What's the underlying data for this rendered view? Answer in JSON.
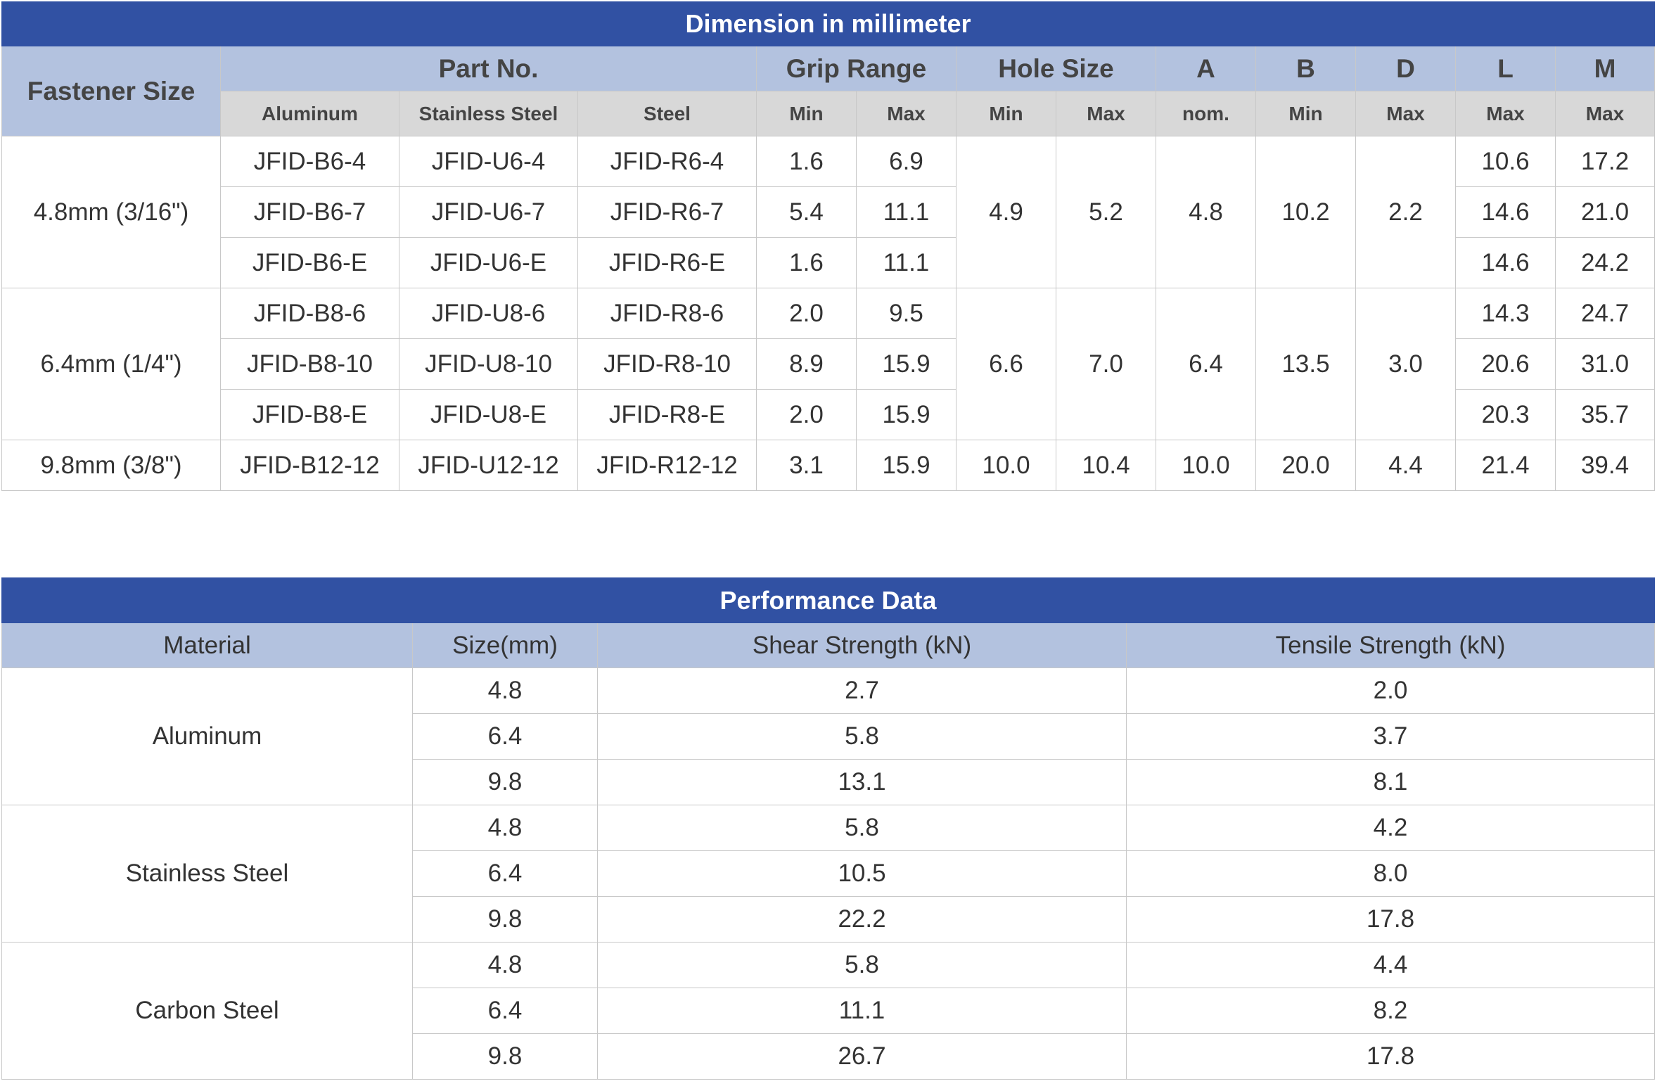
{
  "dimension": {
    "title": "Dimension in millimeter",
    "headers": {
      "fastener_size": "Fastener Size",
      "part_no": "Part No.",
      "grip_range": "Grip Range",
      "hole_size": "Hole Size",
      "a": "A",
      "b": "B",
      "d": "D",
      "l": "L",
      "m": "M"
    },
    "subheaders": {
      "aluminum": "Aluminum",
      "stainless": "Stainless Steel",
      "steel": "Steel",
      "grip_min": "Min",
      "grip_max": "Max",
      "hole_min": "Min",
      "hole_max": "Max",
      "a": "nom.",
      "b": "Min",
      "d": "Max",
      "l": "Max",
      "m": "Max"
    },
    "groups": [
      {
        "size": "4.8mm (3/16\")",
        "hole_min": "4.9",
        "hole_max": "5.2",
        "a": "4.8",
        "b": "10.2",
        "d": "2.2",
        "rows": [
          {
            "aluminum": "JFID-B6-4",
            "stainless": "JFID-U6-4",
            "steel": "JFID-R6-4",
            "grip_min": "1.6",
            "grip_max": "6.9",
            "l": "10.6",
            "m": "17.2"
          },
          {
            "aluminum": "JFID-B6-7",
            "stainless": "JFID-U6-7",
            "steel": "JFID-R6-7",
            "grip_min": "5.4",
            "grip_max": "11.1",
            "l": "14.6",
            "m": "21.0"
          },
          {
            "aluminum": "JFID-B6-E",
            "stainless": "JFID-U6-E",
            "steel": "JFID-R6-E",
            "grip_min": "1.6",
            "grip_max": "11.1",
            "l": "14.6",
            "m": "24.2"
          }
        ]
      },
      {
        "size": "6.4mm (1/4\")",
        "hole_min": "6.6",
        "hole_max": "7.0",
        "a": "6.4",
        "b": "13.5",
        "d": "3.0",
        "rows": [
          {
            "aluminum": "JFID-B8-6",
            "stainless": "JFID-U8-6",
            "steel": "JFID-R8-6",
            "grip_min": "2.0",
            "grip_max": "9.5",
            "l": "14.3",
            "m": "24.7"
          },
          {
            "aluminum": "JFID-B8-10",
            "stainless": "JFID-U8-10",
            "steel": "JFID-R8-10",
            "grip_min": "8.9",
            "grip_max": "15.9",
            "l": "20.6",
            "m": "31.0"
          },
          {
            "aluminum": "JFID-B8-E",
            "stainless": "JFID-U8-E",
            "steel": "JFID-R8-E",
            "grip_min": "2.0",
            "grip_max": "15.9",
            "l": "20.3",
            "m": "35.7"
          }
        ]
      },
      {
        "size": "9.8mm (3/8\")",
        "hole_min": "10.0",
        "hole_max": "10.4",
        "a": "10.0",
        "b": "20.0",
        "d": "4.4",
        "rows": [
          {
            "aluminum": "JFID-B12-12",
            "stainless": "JFID-U12-12",
            "steel": "JFID-R12-12",
            "grip_min": "3.1",
            "grip_max": "15.9",
            "l": "21.4",
            "m": "39.4"
          }
        ]
      }
    ]
  },
  "performance": {
    "title": "Performance Data",
    "headers": {
      "material": "Material",
      "size": "Size(mm)",
      "shear": "Shear Strength (kN)",
      "tensile": "Tensile Strength (kN)"
    },
    "groups": [
      {
        "material": "Aluminum",
        "rows": [
          {
            "size": "4.8",
            "shear": "2.7",
            "tensile": "2.0"
          },
          {
            "size": "6.4",
            "shear": "5.8",
            "tensile": "3.7"
          },
          {
            "size": "9.8",
            "shear": "13.1",
            "tensile": "8.1"
          }
        ]
      },
      {
        "material": "Stainless Steel",
        "rows": [
          {
            "size": "4.8",
            "shear": "5.8",
            "tensile": "4.2"
          },
          {
            "size": "6.4",
            "shear": "10.5",
            "tensile": "8.0"
          },
          {
            "size": "9.8",
            "shear": "22.2",
            "tensile": "17.8"
          }
        ]
      },
      {
        "material": "Carbon Steel",
        "rows": [
          {
            "size": "4.8",
            "shear": "5.8",
            "tensile": "4.4"
          },
          {
            "size": "6.4",
            "shear": "11.1",
            "tensile": "8.2"
          },
          {
            "size": "9.8",
            "shear": "26.7",
            "tensile": "17.8"
          }
        ]
      }
    ]
  }
}
